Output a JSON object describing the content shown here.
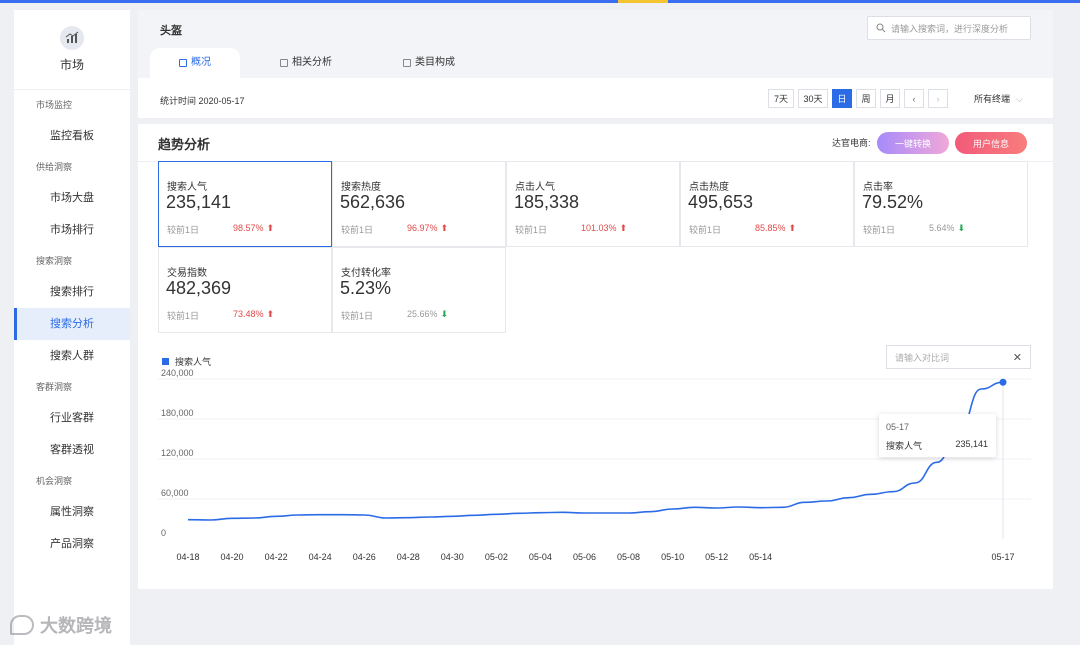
{
  "sidebar": {
    "logo_label": "市场",
    "groups": [
      {
        "label": "市场监控",
        "items": [
          {
            "label": "监控看板"
          }
        ]
      },
      {
        "label": "供给洞察",
        "items": [
          {
            "label": "市场大盘"
          },
          {
            "label": "市场排行"
          }
        ]
      },
      {
        "label": "搜索洞察",
        "items": [
          {
            "label": "搜索排行"
          },
          {
            "label": "搜索分析"
          },
          {
            "label": "搜索人群"
          }
        ]
      },
      {
        "label": "客群洞察",
        "items": [
          {
            "label": "行业客群"
          },
          {
            "label": "客群透视"
          }
        ]
      },
      {
        "label": "机会洞察",
        "items": [
          {
            "label": "属性洞察"
          },
          {
            "label": "产品洞察"
          }
        ]
      }
    ],
    "active_item": "搜索分析"
  },
  "header": {
    "title": "头盔",
    "search_placeholder": "请输入搜索词，进行深度分析",
    "tabs": [
      {
        "label": "概况"
      },
      {
        "label": "相关分析"
      },
      {
        "label": "类目构成"
      }
    ],
    "active_tab": "概况",
    "stat_time": "统计时间 2020-05-17",
    "periods": [
      "7天",
      "30天",
      "日",
      "周",
      "月"
    ],
    "active_period": "日",
    "prev": "‹",
    "next": "›",
    "terminal": "所有终端"
  },
  "main": {
    "title": "趋势分析",
    "ecom_label": "达官电商:",
    "convert_label": "一键转换",
    "user_label": "用户信息",
    "metrics": [
      {
        "label": "搜索人气",
        "value": "235,141",
        "compare": "较前1日",
        "pct": "98.57%",
        "dir": "up"
      },
      {
        "label": "搜索热度",
        "value": "562,636",
        "compare": "较前1日",
        "pct": "96.97%",
        "dir": "up"
      },
      {
        "label": "点击人气",
        "value": "185,338",
        "compare": "较前1日",
        "pct": "101.03%",
        "dir": "up"
      },
      {
        "label": "点击热度",
        "value": "495,653",
        "compare": "较前1日",
        "pct": "85.85%",
        "dir": "up"
      },
      {
        "label": "点击率",
        "value": "79.52%",
        "compare": "较前1日",
        "pct": "5.64%",
        "dir": "down"
      },
      {
        "label": "交易指数",
        "value": "482,369",
        "compare": "较前1日",
        "pct": "73.48%",
        "dir": "up"
      },
      {
        "label": "支付转化率",
        "value": "5.23%",
        "compare": "较前1日",
        "pct": "25.66%",
        "dir": "down"
      }
    ],
    "compare_placeholder": "请输入对比词",
    "compare_clear": "✕",
    "tooltip": {
      "date": "05-17",
      "name": "搜索人气",
      "value": "235,141"
    }
  },
  "chart_data": {
    "type": "line",
    "series": [
      {
        "name": "搜索人气",
        "color": "#2b6be6",
        "values": [
          29000,
          28500,
          31000,
          31500,
          34000,
          36000,
          36500,
          36500,
          36000,
          31500,
          32000,
          33000,
          34000,
          35500,
          37000,
          38500,
          39500,
          40000,
          39000,
          39000,
          39000,
          41000,
          45000,
          47500,
          46500,
          48000,
          47000,
          47500,
          55000,
          57000,
          62000,
          67000,
          71000,
          84000,
          115000,
          160000,
          225000,
          235141
        ]
      }
    ],
    "x_labels": [
      "04-18",
      "04-20",
      "04-22",
      "04-24",
      "04-26",
      "04-28",
      "04-30",
      "05-02",
      "05-04",
      "05-06",
      "05-08",
      "05-10",
      "05-12",
      "05-14",
      "05-17"
    ],
    "ylim": [
      0,
      240000
    ],
    "yticks": [
      "0",
      "60,000",
      "120,000",
      "180,000",
      "240,000"
    ],
    "grid": true
  },
  "watermark": "大数跨境"
}
